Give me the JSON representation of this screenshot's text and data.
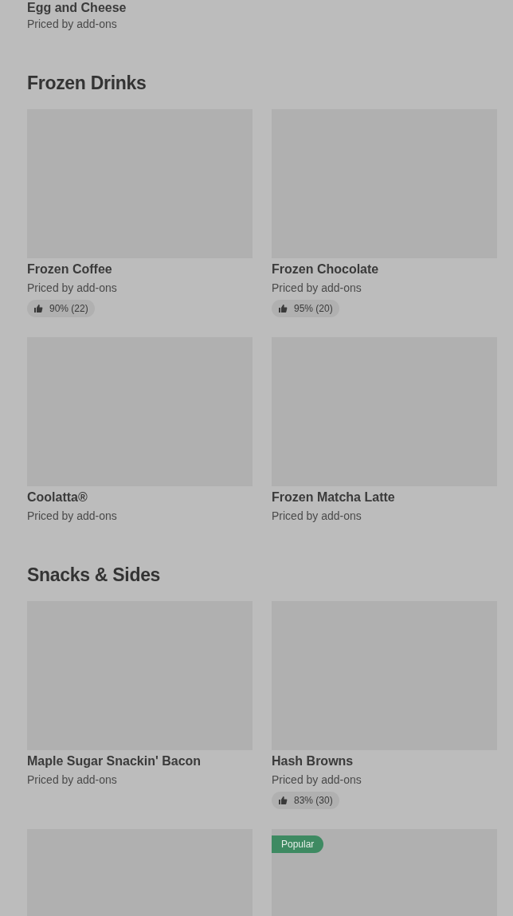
{
  "top_item": {
    "name": "Egg and Cheese",
    "subtitle": "Priced by add-ons"
  },
  "sections": [
    {
      "title": "Frozen Drinks",
      "items": [
        {
          "kind": "card",
          "name": "Frozen Coffee",
          "subtitle": "Priced by add-ons",
          "rating": "90% (22)"
        },
        {
          "kind": "card",
          "name": "Frozen Chocolate",
          "subtitle": "Priced by add-ons",
          "rating": "95% (20)"
        },
        {
          "kind": "card",
          "name": "Coolatta®",
          "subtitle": "Priced by add-ons"
        },
        {
          "kind": "card",
          "name": "Frozen Matcha Latte",
          "subtitle": "Priced by add-ons"
        }
      ]
    },
    {
      "title": "Snacks & Sides",
      "items": [
        {
          "kind": "card",
          "name": "Maple Sugar Snackin' Bacon",
          "subtitle": "Priced by add-ons"
        },
        {
          "kind": "card",
          "name": "Hash Browns",
          "subtitle": "Priced by add-ons",
          "rating": "83% (30)"
        },
        {
          "kind": "card"
        },
        {
          "kind": "card",
          "badge": "Popular"
        }
      ]
    }
  ]
}
